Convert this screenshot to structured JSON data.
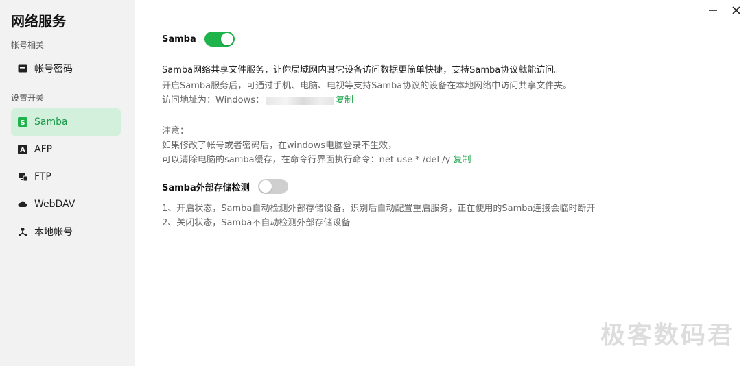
{
  "app": {
    "title": "网络服务"
  },
  "window": {
    "minimize_icon": "minus-icon",
    "close_icon": "close-icon"
  },
  "sidebar": {
    "sections": [
      {
        "label": "帐号相关"
      },
      {
        "label": "设置开关"
      }
    ],
    "items": [
      {
        "label": "帐号密码",
        "icon": "id-card-icon",
        "active": false
      },
      {
        "label": "Samba",
        "icon": "samba-s-icon",
        "active": true
      },
      {
        "label": "AFP",
        "icon": "afp-a-icon",
        "active": false
      },
      {
        "label": "FTP",
        "icon": "ftp-computer-icon",
        "active": false
      },
      {
        "label": "WebDAV",
        "icon": "cloud-icon",
        "active": false
      },
      {
        "label": "本地帐号",
        "icon": "network-user-icon",
        "active": false
      }
    ]
  },
  "main": {
    "samba": {
      "label": "Samba",
      "enabled": true
    },
    "description": "Samba网络共享文件服务，让你局域网内其它设备访问数据更简单快捷，支持Samba协议就能访问。",
    "info": "开启Samba服务后，可通过手机、电脑、电视等支持Samba协议的设备在本地网络中访问共享文件夹。",
    "address_prefix": "访问地址为：Windows：",
    "copy_label": "复制",
    "note_title": "注意：",
    "note_line1": "如果修改了帐号或者密码后，在windows电脑登录不生效，",
    "note_line2": "可以清除电脑的samba缓存，在命令行界面执行命令：net use * /del /y",
    "external": {
      "label": "Samba外部存储检测",
      "enabled": false
    },
    "ext_line1": "1、开启状态，Samba自动检测外部存储设备，识别后自动配置重启服务，正在使用的Samba连接会临时断开",
    "ext_line2": "2、关闭状态，Samba不自动检测外部存储设备"
  },
  "watermark": "极客数码君",
  "colors": {
    "accent": "#1fb34c",
    "active_bg": "#d3f0dc",
    "sidebar_bg": "#f2f2f2",
    "toggle_off": "#cfcfcf"
  }
}
